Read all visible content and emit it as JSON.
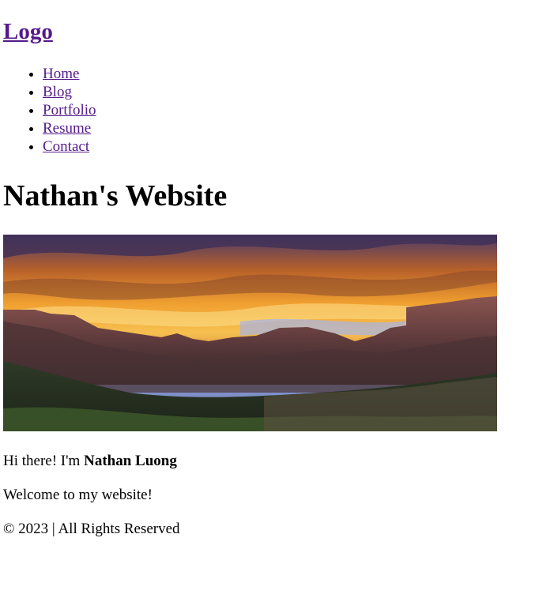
{
  "header": {
    "logo_text": "Logo"
  },
  "nav": {
    "items": [
      {
        "label": "Home"
      },
      {
        "label": "Blog"
      },
      {
        "label": "Portfolio"
      },
      {
        "label": "Resume"
      },
      {
        "label": "Contact"
      }
    ]
  },
  "main": {
    "title": "Nathan's Website",
    "hero_image": "sunset-canyon-landscape",
    "intro_prefix": "Hi there! I'm ",
    "intro_name": "Nathan Luong",
    "welcome": "Welcome to my website!"
  },
  "footer": {
    "text": "© 2023 | All Rights Reserved"
  },
  "colors": {
    "link_visited": "#551a8b",
    "text": "#000000",
    "background": "#ffffff"
  }
}
